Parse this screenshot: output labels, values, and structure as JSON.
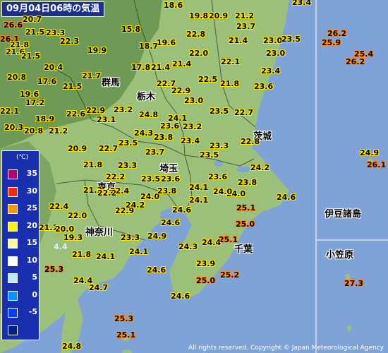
{
  "title": "09月04日06時の気温",
  "legend": {
    "unit": "(℃)",
    "levels": [
      {
        "label": "35",
        "color": "#b4006a"
      },
      {
        "label": "30",
        "color": "#ff2800"
      },
      {
        "label": "25",
        "color": "#ff9900"
      },
      {
        "label": "20",
        "color": "#fff500"
      },
      {
        "label": "15",
        "color": "#fffaa0"
      },
      {
        "label": "10",
        "color": "#ffffff"
      },
      {
        "label": "5",
        "color": "#b9ebff"
      },
      {
        "label": "0",
        "color": "#0096ff"
      },
      {
        "label": "-5",
        "color": "#0041ff"
      },
      {
        "label": "",
        "color": "#002080"
      }
    ]
  },
  "places": [
    "群馬",
    "栃木",
    "茨城",
    "埼玉",
    "東京",
    "神奈川",
    "千葉",
    "伊豆諸島",
    "小笠原"
  ],
  "temperatures": [
    "18.6",
    "19.8",
    "20.9",
    "21.2",
    "23.4",
    "26.1",
    "20.7",
    "23.3",
    "15.8",
    "22.3",
    "21.8",
    "23.0",
    "22.8",
    "23.7",
    "23.5",
    "19.6",
    "21.6",
    "18.7",
    "19.6",
    "21.4",
    "21.5",
    "23.0",
    "26.2",
    "25.9",
    "19.9",
    "22.0",
    "23.0",
    "25.4",
    "26.2",
    "17.8",
    "21.4",
    "21.4",
    "22.1",
    "23.4",
    "21.7",
    "17.6",
    "21.5",
    "22.7",
    "21.8",
    "22.9",
    "23.6",
    "23.0",
    "22.5",
    "17.2",
    "22.1",
    "22.9",
    "23.2",
    "18.9",
    "22.6",
    "23.1",
    "24.1",
    "23.5",
    "22.7",
    "24.8",
    "20.3",
    "20.8",
    "21.2",
    "23.2",
    "24.3",
    "23.6",
    "23.8",
    "22.8",
    "20.9",
    "22.7",
    "23.5",
    "23.7",
    "23.4",
    "23.3",
    "23.5",
    "24.9",
    "26.1",
    "21.8",
    "23.3",
    "24.2",
    "22.4",
    "23.5",
    "23.6",
    "23.6",
    "23.8",
    "21.3",
    "22.2",
    "24.0",
    "24.6",
    "22.4",
    "24.0",
    "24.1",
    "25.1",
    "22.0",
    "22.9",
    "24.6",
    "21.1",
    "20.0",
    "19.3",
    "24.6",
    "23.3",
    "24.9",
    "25.1",
    "4.4",
    "21.8",
    "24.1",
    "24.3",
    "24.4",
    "25.3",
    "24.1",
    "23.9",
    "24.6",
    "25.0",
    "25.2",
    "24.7",
    "27.3",
    "24.6",
    "25.3",
    "25.1",
    "24.8",
    "19.6",
    "24.4",
    "20.8",
    "20.4",
    "25.0",
    "26.6",
    "24.1",
    "24.0",
    "23.8",
    "24.2",
    "22.2",
    "21.5"
  ],
  "copyright": "All rights reserved. Copyright © Japan Meteorological Agency"
}
